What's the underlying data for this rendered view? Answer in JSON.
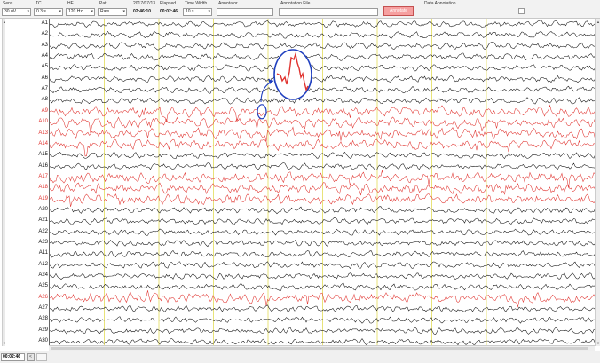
{
  "toolbar": {
    "sens": {
      "label": "Sens",
      "value": "30 uV"
    },
    "tc": {
      "label": "TC",
      "value": "0.3 s"
    },
    "hf": {
      "label": "HF",
      "value": "120 Hz"
    },
    "pat": {
      "label": "Pat",
      "value": "Raw"
    },
    "date": {
      "label": "2017/07/13",
      "value": "02:46:10"
    },
    "elapsed": {
      "label": "Elapsed",
      "value": "00:02:46"
    },
    "time_width": {
      "label": "Time Width",
      "value": "10 s"
    },
    "annotator": {
      "label": "Annotator",
      "value": ""
    },
    "annotation_file": {
      "label": "Annotation File",
      "value": ""
    },
    "annotate_button": "Annotate",
    "data_annotation": {
      "label": "Data Annotation"
    }
  },
  "channels": [
    {
      "label": "A1",
      "color": "#111111"
    },
    {
      "label": "A2",
      "color": "#111111"
    },
    {
      "label": "A3",
      "color": "#111111"
    },
    {
      "label": "A4",
      "color": "#111111"
    },
    {
      "label": "A5",
      "color": "#111111"
    },
    {
      "label": "A6",
      "color": "#111111"
    },
    {
      "label": "A7",
      "color": "#111111"
    },
    {
      "label": "A8",
      "color": "#111111"
    },
    {
      "label": "A9",
      "color": "#e0332f"
    },
    {
      "label": "A10",
      "color": "#e0332f"
    },
    {
      "label": "A13",
      "color": "#e0332f"
    },
    {
      "label": "A14",
      "color": "#e0332f"
    },
    {
      "label": "A15",
      "color": "#111111"
    },
    {
      "label": "A16",
      "color": "#111111"
    },
    {
      "label": "A17",
      "color": "#e0332f"
    },
    {
      "label": "A18",
      "color": "#e0332f"
    },
    {
      "label": "A19",
      "color": "#e0332f"
    },
    {
      "label": "A20",
      "color": "#111111"
    },
    {
      "label": "A21",
      "color": "#111111"
    },
    {
      "label": "A22",
      "color": "#111111"
    },
    {
      "label": "A23",
      "color": "#111111"
    },
    {
      "label": "A11",
      "color": "#111111"
    },
    {
      "label": "A12",
      "color": "#111111"
    },
    {
      "label": "A24",
      "color": "#111111"
    },
    {
      "label": "A25",
      "color": "#111111"
    },
    {
      "label": "A26",
      "color": "#e0332f"
    },
    {
      "label": "A27",
      "color": "#111111"
    },
    {
      "label": "A28",
      "color": "#111111"
    },
    {
      "label": "A29",
      "color": "#111111"
    },
    {
      "label": "A30",
      "color": "#111111"
    }
  ],
  "time_markers": {
    "color": "#d9d020",
    "count": 10
  },
  "status_bar": {
    "time": "00:02:46",
    "nav_button": "<"
  },
  "colors": {
    "highlight_channel": "#e0332f",
    "normal_channel": "#111111",
    "annotation_circle": "#1f3fbf"
  }
}
